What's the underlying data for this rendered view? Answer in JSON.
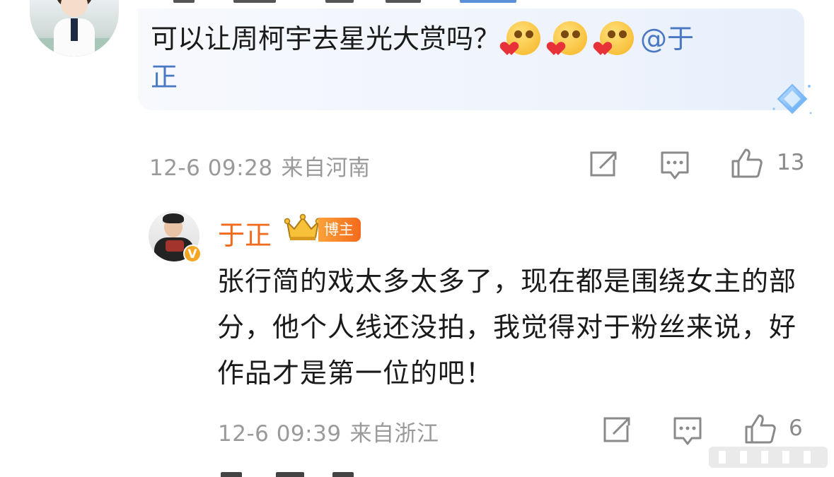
{
  "comment1": {
    "text": "可以让周柯宇去星光大赏吗？",
    "emojis": [
      "blush-heart-emoji",
      "blush-heart-emoji",
      "blush-heart-emoji"
    ],
    "mention_line1": "@于",
    "mention_line2": "正",
    "time": "12-6 09:28",
    "location": "来自河南",
    "like_count": "13"
  },
  "reply": {
    "username": "于正",
    "badge": "博主",
    "verified_mark": "V",
    "text": "张行简的戏太多太多了，现在都是围绕女主的部分，他个人线还没拍，我觉得对于粉丝来说，好作品才是第一位的吧！",
    "time": "12-6 09:39",
    "location": "来自浙江",
    "like_count": "6"
  },
  "icons": {
    "share": "share-icon",
    "comment": "comment-icon",
    "like": "thumbs-up-icon",
    "crown": "crown-icon",
    "gem": "diamond-gem-icon"
  },
  "colors": {
    "username": "#f26b1d",
    "mention": "#4a78c2",
    "meta": "#9a9a9a",
    "bubble": "#eef3fc",
    "badge": "#f36a1c"
  }
}
